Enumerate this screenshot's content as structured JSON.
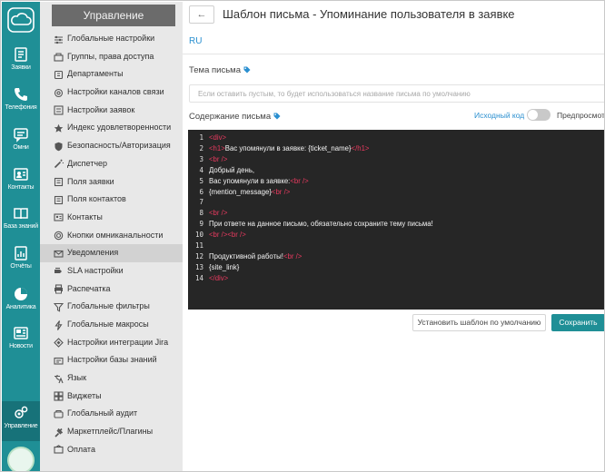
{
  "rail": {
    "items": [
      {
        "label": "Заявки",
        "icon": "tickets-icon"
      },
      {
        "label": "Телефония",
        "icon": "phone-icon"
      },
      {
        "label": "Омни",
        "icon": "chat-icon"
      },
      {
        "label": "Контакты",
        "icon": "contacts-icon"
      },
      {
        "label": "База знаний",
        "icon": "book-icon"
      },
      {
        "label": "Отчёты",
        "icon": "report-icon"
      },
      {
        "label": "Аналитика",
        "icon": "pie-chart-icon"
      },
      {
        "label": "Новости",
        "icon": "news-icon"
      },
      {
        "label": "Управление",
        "icon": "gears-icon"
      }
    ],
    "active_index": 8
  },
  "menu": {
    "title": "Управление",
    "items": [
      {
        "label": "Глобальные настройки",
        "icon": "sliders-icon"
      },
      {
        "label": "Группы, права доступа",
        "icon": "group-icon"
      },
      {
        "label": "Департаменты",
        "icon": "building-icon"
      },
      {
        "label": "Настройки каналов связи",
        "icon": "channels-icon"
      },
      {
        "label": "Настройки заявок",
        "icon": "ticket-settings-icon"
      },
      {
        "label": "Индекс удовлетворенности",
        "icon": "star-icon"
      },
      {
        "label": "Безопасность/Авторизация",
        "icon": "shield-icon"
      },
      {
        "label": "Диспетчер",
        "icon": "wand-icon"
      },
      {
        "label": "Поля заявки",
        "icon": "fields-icon"
      },
      {
        "label": "Поля контактов",
        "icon": "fields-icon"
      },
      {
        "label": "Контакты",
        "icon": "contact-card-icon"
      },
      {
        "label": "Кнопки омниканальности",
        "icon": "omni-button-icon"
      },
      {
        "label": "Уведомления",
        "icon": "envelope-icon"
      },
      {
        "label": "SLA настройки",
        "icon": "sla-icon"
      },
      {
        "label": "Распечатка",
        "icon": "printer-icon"
      },
      {
        "label": "Глобальные фильтры",
        "icon": "filter-icon"
      },
      {
        "label": "Глобальные макросы",
        "icon": "lightning-icon"
      },
      {
        "label": "Настройки интеграции Jira",
        "icon": "jira-icon"
      },
      {
        "label": "Настройки базы знаний",
        "icon": "knowledge-icon"
      },
      {
        "label": "Язык",
        "icon": "language-icon"
      },
      {
        "label": "Виджеты",
        "icon": "widgets-icon"
      },
      {
        "label": "Глобальный аудит",
        "icon": "audit-icon"
      },
      {
        "label": "Маркетплейс/Плагины",
        "icon": "plugin-icon"
      },
      {
        "label": "Оплата",
        "icon": "payment-icon"
      }
    ],
    "active_index": 12
  },
  "page": {
    "back_glyph": "←",
    "title": "Шаблон письма - Упоминание пользователя в заявке",
    "tab": "RU",
    "subject_label": "Тема письма",
    "subject_placeholder": "Если оставить пустым, то будет использоваться название письма по умолчанию",
    "body_label": "Содержание письма",
    "source_code_label": "Исходный код",
    "source_code_on": false,
    "preview_label": "Предпросмотр",
    "default_button": "Установить шаблон по умолчанию",
    "save_button": "Сохранить"
  },
  "editor": {
    "lines": [
      {
        "n": "1",
        "parts": [
          {
            "t": "tag",
            "v": "<div>"
          }
        ]
      },
      {
        "n": "2",
        "parts": [
          {
            "t": "tag",
            "v": "<h1>"
          },
          {
            "t": "text",
            "v": "Вас упомянули в заявке: {ticket_name}"
          },
          {
            "t": "tag",
            "v": "</h1>"
          }
        ]
      },
      {
        "n": "3",
        "parts": [
          {
            "t": "tag",
            "v": "<br />"
          }
        ]
      },
      {
        "n": "4",
        "parts": [
          {
            "t": "text",
            "v": "Добрый день,"
          }
        ]
      },
      {
        "n": "5",
        "parts": [
          {
            "t": "text",
            "v": "Вас упомянули в заявке:"
          },
          {
            "t": "tag",
            "v": "<br />"
          }
        ]
      },
      {
        "n": "6",
        "parts": [
          {
            "t": "text",
            "v": "{mention_message}"
          },
          {
            "t": "tag",
            "v": "<br />"
          }
        ]
      },
      {
        "n": "7",
        "parts": []
      },
      {
        "n": "8",
        "parts": [
          {
            "t": "tag",
            "v": "<br />"
          }
        ]
      },
      {
        "n": "9",
        "parts": [
          {
            "t": "text",
            "v": "При ответе на данное письмо, обязательно сохраните тему письма!"
          }
        ]
      },
      {
        "n": "10",
        "parts": [
          {
            "t": "tag",
            "v": "<br /><br />"
          }
        ]
      },
      {
        "n": "11",
        "parts": []
      },
      {
        "n": "12",
        "parts": [
          {
            "t": "text",
            "v": "Продуктивной работы!"
          },
          {
            "t": "tag",
            "v": "<br />"
          }
        ]
      },
      {
        "n": "13",
        "parts": [
          {
            "t": "text",
            "v": "{site_link}"
          }
        ]
      },
      {
        "n": "14",
        "parts": [
          {
            "t": "tag",
            "v": "</div>"
          }
        ]
      }
    ]
  },
  "colors": {
    "brand": "#1f8f96",
    "link": "#2a8fd0",
    "editor_bg": "#262626",
    "code_tag": "#e83a5f"
  }
}
